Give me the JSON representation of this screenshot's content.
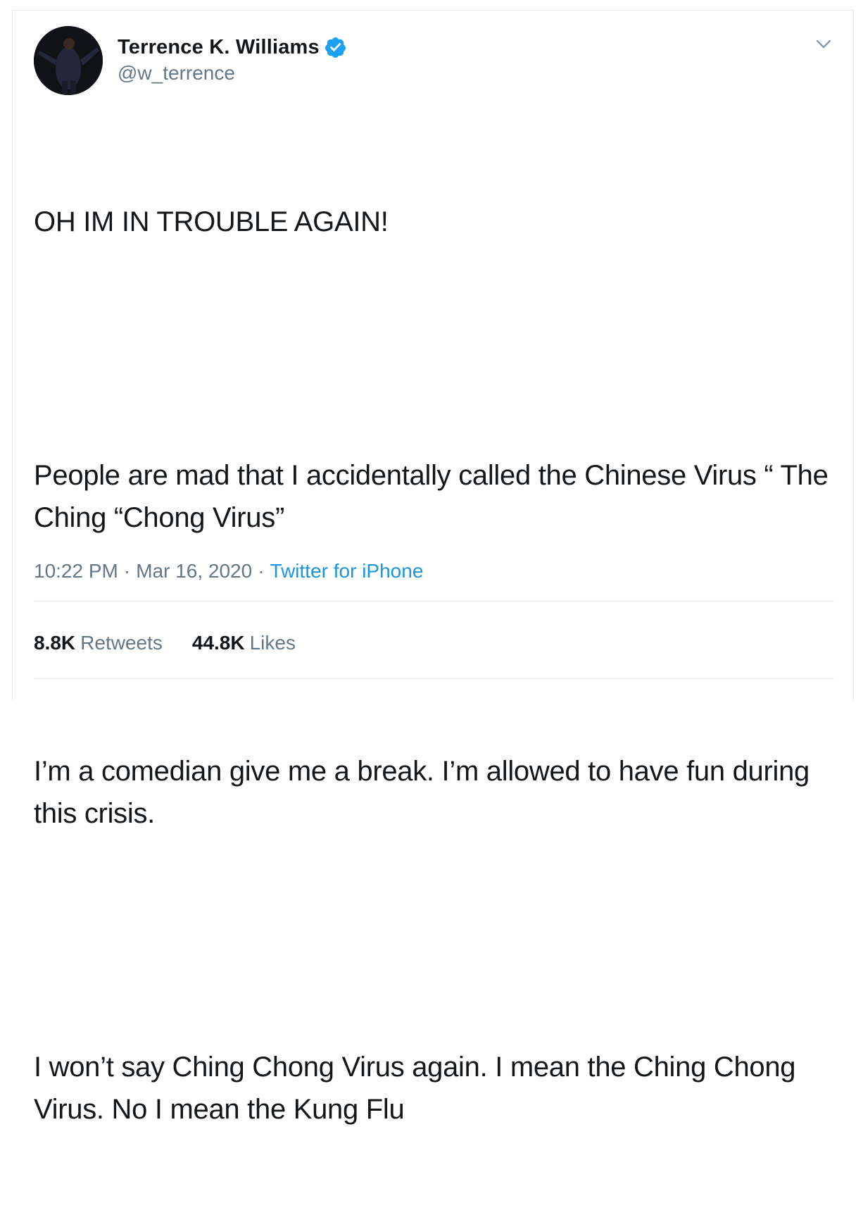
{
  "user": {
    "name": "Terrence K. Williams",
    "handle": "@w_terrence",
    "verified": true
  },
  "tweet": {
    "paragraphs": [
      "OH IM IN TROUBLE AGAIN!",
      "",
      "People are mad that I accidentally called the Chinese Virus “ The Ching “Chong Virus”",
      "",
      "I’m a comedian give me a break. I’m allowed to have fun during this crisis.",
      "",
      "I won’t say Ching Chong Virus again. I mean the Ching Chong Virus. No I mean the Kung Flu"
    ],
    "time": "10:22 PM",
    "date": "Mar 16, 2020",
    "source": "Twitter for iPhone",
    "separator": "·"
  },
  "stats": {
    "retweets_count": "8.8K",
    "retweets_label": "Retweets",
    "likes_count": "44.8K",
    "likes_label": "Likes"
  },
  "colors": {
    "accent": "#1da1f2",
    "link": "#1b95e0",
    "muted": "#657786"
  },
  "icons": {
    "verified": "verified-badge-icon",
    "more": "chevron-down-icon"
  }
}
